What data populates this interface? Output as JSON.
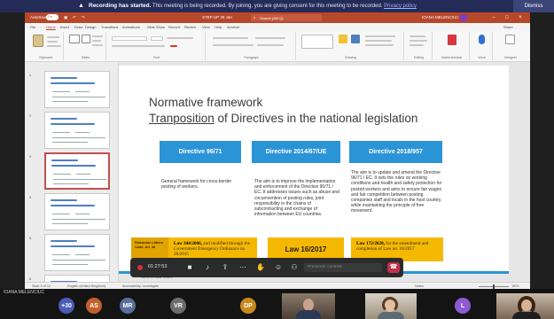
{
  "banner": {
    "text_bold": "Recording has started.",
    "text": " This meeting is being recorded. By joining, you are giving consent for this meeting to be recorded.",
    "privacy_link": "Privacy policy",
    "dismiss_label": "Dismiss"
  },
  "ppt": {
    "autosave": "AutoSave",
    "autosave_state": "On",
    "doc_title": "STEP UP 28 Jan",
    "search_placeholder": "Search (Alt+Q)",
    "user": "IOANA MELENCIUC",
    "menu": [
      "File",
      "Home",
      "Insert",
      "Draw",
      "Design",
      "Transitions",
      "Animations",
      "Slide Show",
      "Record",
      "Review",
      "View",
      "Help",
      "Acrobat"
    ],
    "share_label": "Share",
    "ribbon_groups": [
      "Clipboard",
      "Slides",
      "Font",
      "Paragraph",
      "Drawing",
      "Editing",
      "Adobe Acrobat",
      "Voice",
      "Designer"
    ],
    "status": {
      "slide_of": "Slide 3 of 12",
      "language": "English (United Kingdom)",
      "accessibility": "Accessibility: Investigate",
      "notes": "Notes",
      "zoom": "80%"
    },
    "notes_hint": "Click to add notes"
  },
  "thumbnails": [
    {
      "num": "1"
    },
    {
      "num": "2"
    },
    {
      "num": "3"
    },
    {
      "num": "4"
    },
    {
      "num": "5"
    },
    {
      "num": "6"
    }
  ],
  "slide": {
    "title": "Normative framework",
    "subtitle_underlined": "Tranposition",
    "subtitle_rest": " of Directives in the national legislation",
    "directives": [
      "Directive 96/71",
      "Directive 2014/67/UE",
      "Directive 2018/957"
    ],
    "descriptions": [
      "General framework for cross-border posting of workers.",
      "The aim is to improve the implementation and enforcement of the Directive 96/71 / EC. It addresses issues such as abuse and circumvention of posting rules, joint responsibility in the chains of subcontracting and exchange of information between EU countries.",
      "The aim is to update  and amend the Directive 96/71 / EC. It sets the rules on working conditions and health and safety protection for posted workers and aims to ensure fair wages and fair competition between posting companies staff and locals in the host country, while maintaining the principle of free movement."
    ],
    "law_side": "Romanian Labour Code, Art. 46",
    "law1_bold": "Law 344/2006,",
    "law1_rest": " and modified through the Government Emergency Ordinance no. 28/2015",
    "law2": "Law 16/2017",
    "law3_bold": "Law 172/2020,",
    "law3_rest": " for the amendment and completion of Law no. 16/2017"
  },
  "meeting": {
    "timer": "01:27:53",
    "input_placeholder": "Presenter controls",
    "presenter": "IOANA MELENCIUC",
    "participants": [
      {
        "initials": "+30",
        "color": "#4a5bb8"
      },
      {
        "initials": "AS",
        "color": "#c2612f"
      },
      {
        "initials": "MR",
        "color": "#5a6f9a"
      },
      {
        "initials": "VR",
        "color": "#6e6e6e"
      },
      {
        "initials": "DP",
        "color": "#c98a1b"
      },
      {
        "initials": "L",
        "color": "#8c5ad1"
      }
    ]
  }
}
